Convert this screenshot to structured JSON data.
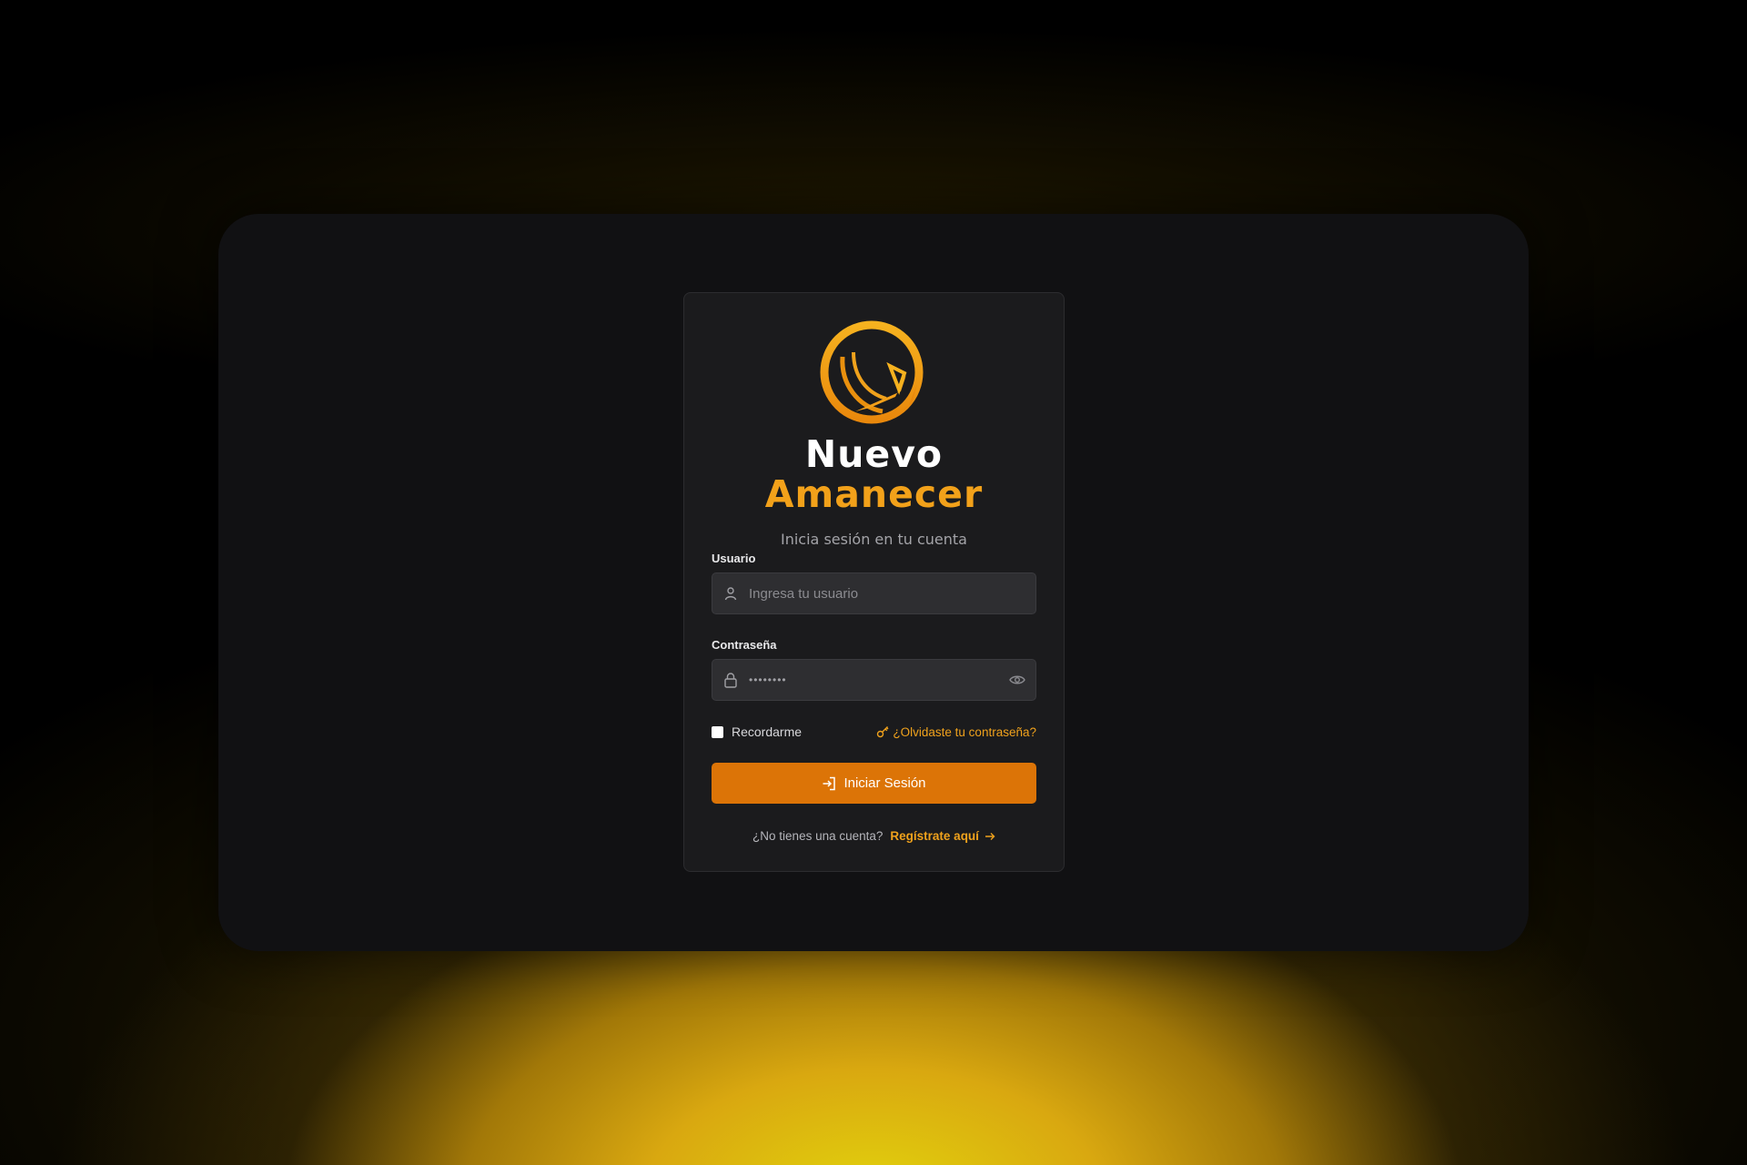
{
  "brand": {
    "name_line1": "Nuevo",
    "name_line2": "Amanecer",
    "logo_icon": "sunrise-logo-icon",
    "accent_color": "#f2a11a"
  },
  "login": {
    "subtitle": "Inicia sesión en tu cuenta",
    "username_label": "Usuario",
    "username_placeholder": "Ingresa tu usuario",
    "username_value": "",
    "username_icon": "user-icon",
    "password_label": "Contraseña",
    "password_value": "••••••••",
    "password_icon": "lock-icon",
    "toggle_visibility_icon": "eye-icon",
    "remember_label": "Recordarme",
    "remember_checked": false,
    "forgot_label": "¿Olvidaste tu contraseña?",
    "forgot_icon": "key-icon",
    "submit_label": "Iniciar Sesión",
    "submit_icon": "sign-in-icon",
    "button_color": "#dc7407",
    "signup_prompt": "¿No tienes una cuenta?",
    "signup_link": "Regístrate aquí",
    "signup_icon": "arrow-right-icon"
  }
}
